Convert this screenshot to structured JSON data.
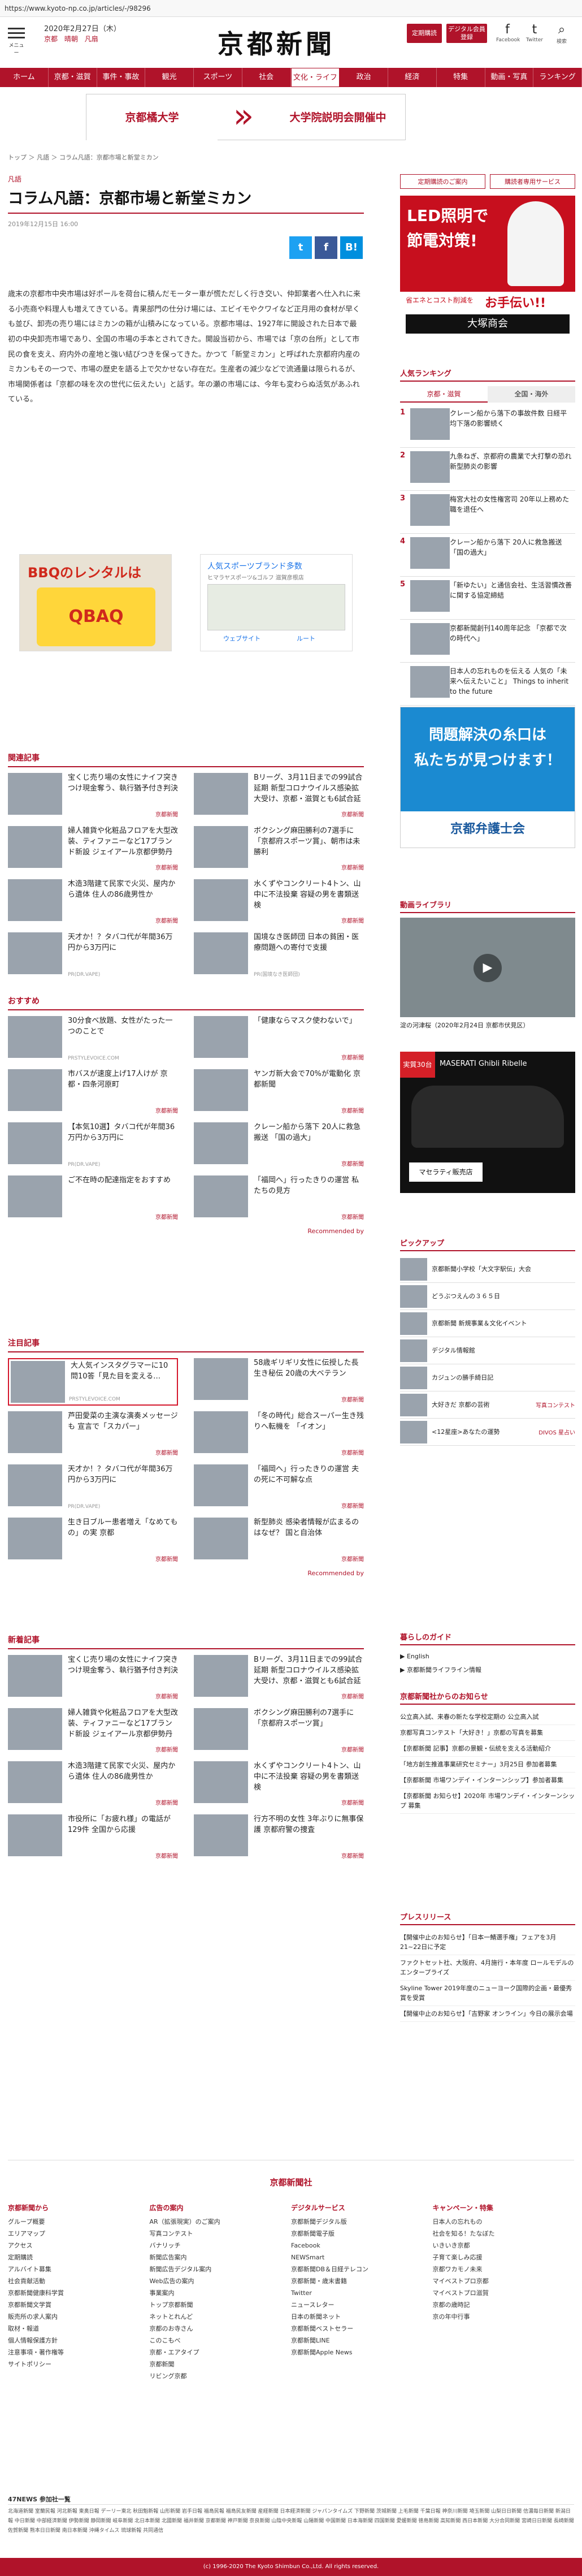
{
  "url": "https://www.kyoto-np.co.jp/articles/-/98296",
  "header": {
    "menu_label": "メニュー",
    "date": "2020年2月27日（木）",
    "weather": [
      "京都",
      "晴朝",
      "凡扇"
    ],
    "logo": "京都新聞",
    "btn_login": "定期購読",
    "btn_digital": "デジタル会員登録",
    "icons": [
      {
        "name": "facebook-icon",
        "glyph": "f",
        "label": "Facebook"
      },
      {
        "name": "twitter-icon",
        "glyph": "t",
        "label": "Twitter"
      },
      {
        "name": "search-icon",
        "glyph": "⌕",
        "label": "検索"
      }
    ]
  },
  "nav": [
    "ホーム",
    "京都・滋賀",
    "事件・事故",
    "観光",
    "スポーツ",
    "社会",
    "文化・ライフ",
    "政治",
    "経済",
    "特集",
    "動画・写真",
    "ランキング"
  ],
  "nav_active": 6,
  "banner": {
    "left": "京都橘大学",
    "right": "大学院説明会開催中"
  },
  "breadcrumb": "トップ ＞ 凡語 ＞ コラム凡語：京都市場と新堂ミカン",
  "article": {
    "category": "凡語",
    "title": "コラム凡語：京都市場と新堂ミカン",
    "date": "2019年12月15日 16:00",
    "share": [
      {
        "name": "twitter-share-button",
        "label": "t",
        "color": "#1da1f2"
      },
      {
        "name": "facebook-share-button",
        "label": "f",
        "color": "#3b5998"
      },
      {
        "name": "hatena-share-button",
        "label": "B!",
        "color": "#008fde"
      }
    ],
    "body": "歳末の京都市中央市場は好ポールを荷台に積んだモーター車が慌ただしく行き交い、仲卸業者へ仕入れに来る小売商や料理人も増えてきている。青果部門の仕分け場には、エビイモやクワイなど正月用の食材が早くも並び、卸売の売り場にはミカンの箱が山積みになっている。京都市場は、1927年に開設された日本で最初の中央卸売市場であり、全国の市場の手本とされてきた。開設当初から、市場では「京の台所」として市民の食を支え、府内外の産地と強い結びつきを保ってきた。かつて「新堂ミカン」と呼ばれた京都府内産のミカンもその一つで、市場の歴史を語る上で欠かせない存在だ。生産者の減少などで流通量は限られるが、市場関係者は「京都の味を次の世代に伝えたい」と話す。年の瀬の市場には、今年も変わらぬ活気があふれている。"
  },
  "ads": {
    "bbq_title": "BBQのレンタルは",
    "bbq_brand": "QBAQ",
    "sport_title": "人気スポーツブランド多数",
    "sport_url": "ヒマラヤスポーツ&ゴルフ 滋賀彦根店",
    "sport_route": "ルート",
    "sport_site": "ウェブサイト"
  },
  "related": {
    "heading": "関連記事",
    "items": [
      {
        "text": "宝くじ売り場の女性にナイフ突きつけ現金奪う、執行猶予付き判決",
        "source": "",
        "tag": "京都新聞"
      },
      {
        "text": "Bリーグ、3月11日までの99試合延期 新型コロナウイルス感染拡大受け、京都・滋賀とも6試合延期",
        "source": "",
        "tag": "京都新聞"
      },
      {
        "text": "婦人雑貨や化粧品フロアを大型改装、ティファニーなど17ブランド新設 ジェイアール京都伊勢丹",
        "source": "",
        "tag": "京都新聞"
      },
      {
        "text": "ボクシング麻田勝利の7選手に「京都府スポーツ賞」、朝市は未勝利",
        "source": "",
        "tag": "京都新聞"
      },
      {
        "text": "木造3階建て民家で火災、屋内から遺体 住人の86歳男性か",
        "source": "",
        "tag": "京都新聞"
      },
      {
        "text": "水くずやコンクリート4トン、山中に不法投棄 容疑の男を書類送検",
        "source": "",
        "tag": "京都新聞"
      },
      {
        "text": "天才か！？タバコ代が年間36万円から3万円に",
        "source": "PR(DR.VAPE)",
        "tag": ""
      },
      {
        "text": "国境なき医師団 日本の貧困・医療問題への寄付で支援",
        "source": "PR(国境なき医師団)",
        "tag": ""
      }
    ]
  },
  "recommend": {
    "heading": "おすすめ",
    "items": [
      {
        "text": "30分食べ放題、女性がたった一つのことで",
        "source": "PRSTYLEVOICE.COM",
        "tag": ""
      },
      {
        "text": "「健康ならマスク使わないで」",
        "source": "",
        "tag": "京都新聞"
      },
      {
        "text": "市バスが速度上げ17人けが 京都・四条河原町",
        "source": "",
        "tag": "京都新聞"
      },
      {
        "text": "ヤンガ新大会で70%が電動化 京都新聞",
        "source": "",
        "tag": "京都新聞"
      },
      {
        "text": "【本気10選】タバコ代が年間36万円から3万円に",
        "source": "PR(DR.VAPE)",
        "tag": ""
      },
      {
        "text": "クレーン船から落下 20人に救急搬送 「国の過大」",
        "source": "",
        "tag": "京都新聞"
      },
      {
        "text": "ご不在時の配達指定をおすすめ",
        "source": "",
        "tag": "京都新聞"
      },
      {
        "text": "「福岡へ」行ったきりの運営 私たちの見方",
        "source": "",
        "tag": "京都新聞"
      }
    ],
    "credit": "Recommended by"
  },
  "attention": {
    "heading": "注目記事",
    "items": [
      {
        "text": "大人気インスタグラマーに10問10答「見た目を変える…",
        "source": "PRSTYLEVOICE.COM",
        "tag": "",
        "highlight": true
      },
      {
        "text": "58歳ギリギリ女性に伝授した長生き秘伝 20歳の大ベテラン",
        "source": "",
        "tag": "京都新聞"
      },
      {
        "text": "芦田愛菜の主演な演奏メッセージも 宣言で「スカパー」",
        "source": "",
        "tag": "京都新聞"
      },
      {
        "text": "「冬の時代」総合スーパー生き残りへ転機を 「イオン」",
        "source": "",
        "tag": "京都新聞"
      },
      {
        "text": "天才か！？タバコ代が年間36万円から3万円に",
        "source": "PR(DR.VAPE)",
        "tag": ""
      },
      {
        "text": "「福岡へ」行ったきりの運営 夫の死に不可解な点",
        "source": "",
        "tag": "京都新聞"
      },
      {
        "text": "生き日ブルー患者増え「なめてもの」の実 京都",
        "source": "",
        "tag": "京都新聞"
      },
      {
        "text": "新型肺炎 感染者情報が広まるのはなぜ？ 国と自治体",
        "source": "",
        "tag": "京都新聞"
      }
    ],
    "credit": "Recommended by"
  },
  "newest": {
    "heading": "新着記事",
    "items": [
      {
        "text": "宝くじ売り場の女性にナイフ突きつけ現金奪う、執行猶予付き判決",
        "tag": "京都新聞"
      },
      {
        "text": "Bリーグ、3月11日までの99試合延期 新型コロナウイルス感染拡大受け、京都・滋賀とも6試合延期",
        "tag": "京都新聞"
      },
      {
        "text": "婦人雑貨や化粧品フロアを大型改装、ティファニーなど17ブランド新設 ジェイアール京都伊勢丹",
        "tag": "京都新聞"
      },
      {
        "text": "ボクシング麻田勝利の7選手に「京都府スポーツ賞」",
        "tag": "京都新聞"
      },
      {
        "text": "木造3階建て民家で火災、屋内から遺体 住人の86歳男性か",
        "tag": "京都新聞"
      },
      {
        "text": "水くずやコンクリート4トン、山中に不法投棄 容疑の男を書類送検",
        "tag": "京都新聞"
      },
      {
        "text": "市役所に「お疲れ様」の電話が129件 全国から応援",
        "tag": "京都新聞"
      },
      {
        "text": "行方不明の女性 3年ぶりに無事保護 京都府警の捜査",
        "tag": "京都新聞"
      }
    ]
  },
  "sidebar": {
    "links": [
      "定期購読のご案内",
      "購読者専用サービス"
    ],
    "ad_led": {
      "line1": "LED照明で",
      "line2": "節電対策!",
      "line3": "省エネとコスト削減を",
      "line4": "お手伝い!!",
      "brand": "大塚商会"
    },
    "ranking_heading": "人気ランキング",
    "ranking_tabs": [
      "京都・滋賀",
      "全国・海外"
    ],
    "ranking": [
      {
        "n": "1",
        "text": "クレーン船から落下の事故件数 日経平均下落の影響続く"
      },
      {
        "n": "2",
        "text": "九条ねぎ、京都府の農業で大打撃の恐れ 新型肺炎の影響"
      },
      {
        "n": "3",
        "text": "梅宮大社の女性権宮司 20年以上務めた職を退任へ"
      },
      {
        "n": "4",
        "text": "クレーン船から落下 20人に救急搬送 「国の過大」"
      },
      {
        "n": "5",
        "text": "「新ゆたい」と通信会社、生活習慣改善に関する協定締結"
      },
      {
        "n": "",
        "text": "京都新聞創刊140周年記念 「京都で次の時代へ」"
      },
      {
        "n": "",
        "text": "日本人の忘れものを伝える 人気の「未来へ伝えたいこと」 Things to inherit to the future"
      }
    ],
    "ad_bengoshi": {
      "line1": "問題解決の糸口は",
      "line2": "私たちが見つけます！",
      "brand": "京都弁護士会"
    },
    "video_heading": "動画ライブラリ",
    "video_caption": "淀の河津桜（2020年2月24日 京都市伏見区）",
    "ad_maserati": {
      "title": "MASERATI Ghibli Ribelle",
      "sub": "マセラティ販売店"
    },
    "pickup_heading": "ピックアップ",
    "pickup": [
      {
        "text": "京都新聞小学校「大文字駅伝」大会",
        "pr": ""
      },
      {
        "text": "どうぶつえんの３６５日",
        "pr": ""
      },
      {
        "text": "京都新聞 新規事業＆文化イベント",
        "pr": ""
      },
      {
        "text": "デジタル情報館",
        "pr": ""
      },
      {
        "text": "カジュンの勝手綺日記",
        "pr": ""
      },
      {
        "text": "大好きだ 京都の芸術",
        "pr": "写真コンテスト"
      },
      {
        "text": "<12星座>あなたの運勢",
        "pr": "DIVOS 星占い"
      }
    ],
    "guide_heading": "暮らしのガイド",
    "guide": [
      "▶ English",
      "▶ 京都新聞ライフライン情報"
    ],
    "notice_heading": "京都新聞社からのお知らせ",
    "notice": [
      "公立高入試、来春の新たな学校定期の 公立高入試",
      "京都写真コンテスト「大好き！」京都の写真を募集",
      "【京都新聞 記事】京都の景観・伝統を支える活動紹介",
      "「地方創生推進事業研究セミナー」3月25日 参加者募集",
      "【京都新聞 市場ワンデイ・インターンシップ】参加者募集",
      "【京都新聞 お知らせ】2020年 市場ワンデイ・インターンシップ 募集"
    ],
    "press_heading": "プレスリリース",
    "press": [
      "【開催中止のお知らせ】「日本一鯖選手権」フェアを3月21~22日に予定",
      "ファクトセット社、大阪府、4月施行・本年度 ロールモデルのエンタープライズ",
      "Skyline Tower 2019年度のニューヨーク国際的企画・最優秀賞を受賞",
      "【開催中止のお知らせ】「吉野家 オンライン」今日の展示会場"
    ]
  },
  "footer": {
    "logo": "京都新聞社",
    "cols": [
      {
        "h": "京都新聞から",
        "items": [
          "グループ概要",
          "エリアマップ",
          "アクセス",
          "定期購読",
          "アルバイト募集",
          "社会貢献活動",
          "京都新聞健康科学賞",
          "京都新聞文学賞",
          "販売所の求人案内",
          "取材・報道",
          "個人情報保護方針",
          "注意事項・著作権等",
          "サイトポリシー"
        ]
      },
      {
        "h": "広告の案内",
        "items": [
          "AR（拡張現実）のご案内",
          "写真コンテスト",
          "バナリッチ",
          "新聞広告案内",
          "新聞広告デジタル案内",
          "Web広告の案内",
          "事業案内",
          "トップ京都新聞",
          "ネットとれんど",
          "京都のお寺さん",
          "このこもべ",
          "京都・エアタイプ",
          "京都新聞",
          "リビング京都"
        ]
      },
      {
        "h": "デジタルサービス",
        "items": [
          "京都新聞デジタル版",
          "京都新聞電子版",
          "Facebook",
          "NEWSmart",
          "京都新聞DB＆日経テレコン",
          "京都新聞・歳末書籍",
          "Twitter",
          "ニュースレター",
          "日本の新聞ネット",
          "京都新聞ベストセラー",
          "京都新聞LINE",
          "京都新聞Apple News"
        ]
      },
      {
        "h": "キャンペーン・特集",
        "items": [
          "日本人の忘れもの",
          "社会を知る！たなぼた",
          "いきいき京都",
          "子育て楽しみ応援",
          "京都ワカモノ未来",
          "マイベストプロ京都",
          "マイベストプロ滋賀",
          "京都の歳時記",
          "京の年中行事"
        ]
      }
    ],
    "news47_heading": "47NEWS 参加社一覧",
    "news47": "北海道新聞 室蘭民報 河北新報 東奥日報 デーリー東北 秋田魁新報 山形新聞 岩手日報 福島民報 福島民友新聞 産経新聞 日本経済新聞 ジャパンタイムズ 下野新聞 茨城新聞 上毛新聞 千葉日報 神奈川新聞 埼玉新聞 山梨日日新聞 信濃毎日新聞 新潟日報 中日新聞 中部経済新聞 伊勢新聞 静岡新聞 岐阜新聞 北日本新聞 北國新聞 福井新聞 京都新聞 神戸新聞 奈良新聞 山陰中央新報 山陽新聞 中国新聞 日本海新聞 四国新聞 愛媛新聞 徳島新聞 高知新聞 西日本新聞 大分合同新聞 宮崎日日新聞 長崎新聞 佐賀新聞 熊本日日新聞 南日本新聞 沖縄タイムス 琉球新報 共同通信",
    "copyright": "(c) 1996-2020 The Kyoto Shimbun Co.,Ltd. All rights reserved."
  }
}
